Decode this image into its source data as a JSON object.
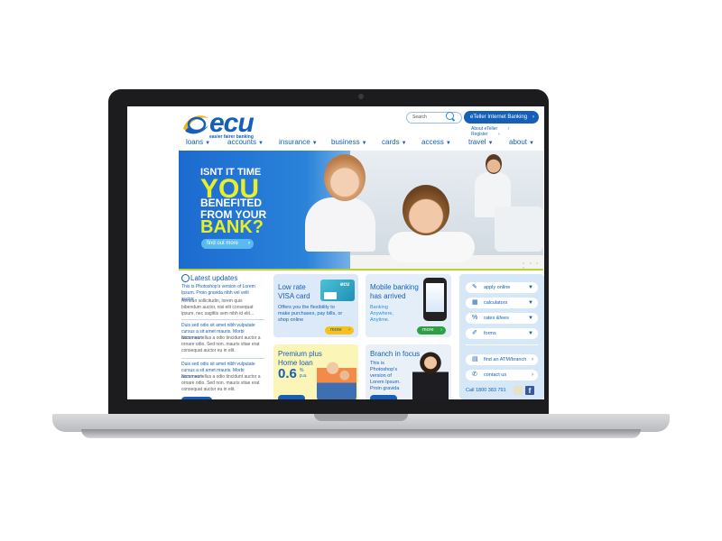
{
  "header": {
    "logo_text": "ecu",
    "tagline": "easier fairer banking",
    "search_placeholder": "Search",
    "eteller_label": "eTeller Internet Banking",
    "links": [
      "About eTeller",
      "Register"
    ]
  },
  "nav": [
    "loans",
    "accounts",
    "insurance",
    "business",
    "cards",
    "access",
    "travel",
    "about"
  ],
  "hero": {
    "line1": "ISNT IT TIME",
    "line2": "YOU",
    "line3": "BENEFITED",
    "line4": "FROM YOUR",
    "line5": "BANK?",
    "cta": "find out more"
  },
  "latest_updates": {
    "title": "Latest updates",
    "items": [
      {
        "headline": "This is Photoshop's version  of Lorem Ipsum. Proin gravida nibh vel velit auctor",
        "body": "Aenean sollicitudin, lorem quis bibendum auctor, nisi elit consequat ipsum, nec sagittis sem nibh id elit..."
      },
      {
        "headline": "Duis sed odio sit amet nibh vulputate cursus a sit amet mauris. Morbi accumsan",
        "body": "Nam nec tellus a odio tincidunt auctor a ornare odio. Sed non. mauris vitae erat consequat auctor eu in elit."
      },
      {
        "headline": "Duis sed odio sit amet nibh vulputate cursus a sit amet mauris. Morbi accumsan",
        "body": "Nam nec tellus a odio tincidunt auctor a ornare odio. Sed non. mauris vitae erat consequat auctor eu in elit."
      }
    ]
  },
  "promos": {
    "visa": {
      "title1": "Low rate",
      "title2": "VISA card",
      "desc": [
        "Offers you the flexibility to",
        "make purchases, pay bills, or",
        "shop online"
      ],
      "more": "more",
      "card_logo": "ecu"
    },
    "mobile": {
      "title1": "Mobile banking",
      "title2": "has arrived",
      "desc": [
        "Banking",
        "Anywhere,",
        "Anytime."
      ],
      "more": "more"
    },
    "premium": {
      "title1": "Premium plus",
      "title2": "Home loan",
      "rate": "0.6",
      "rate_unit1": "%",
      "rate_unit2": "p.a."
    },
    "branch": {
      "title": "Branch in focus",
      "desc": [
        "This is",
        "Photoshop's",
        "version  of",
        "Lorem Ipsum.",
        "Proin gravida"
      ]
    }
  },
  "sidebar": {
    "buttons": [
      {
        "label": "apply online",
        "icon": "pencil-icon"
      },
      {
        "label": "calculators",
        "icon": "calculator-icon"
      },
      {
        "label": "rates &fees",
        "icon": "percent-icon"
      },
      {
        "label": "forms",
        "icon": "form-icon"
      },
      {
        "label": "find an ATM/branch",
        "icon": "map-icon"
      },
      {
        "label": "contact us",
        "icon": "phone-icon"
      }
    ],
    "call": "Call 1800 383 791"
  },
  "colors": {
    "brand_blue": "#1560b6",
    "accent_yellow": "#e8ef2a",
    "lime_rule": "#b8d237",
    "more_yellow": "#f5c11c",
    "more_green": "#2ea043"
  }
}
